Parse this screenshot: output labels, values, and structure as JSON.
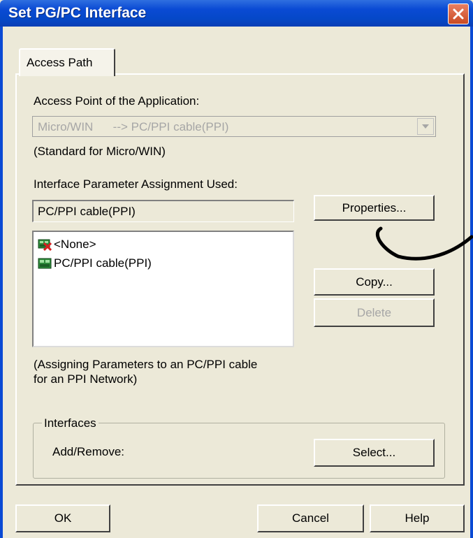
{
  "window": {
    "title": "Set PG/PC Interface"
  },
  "tabs": [
    {
      "label": "Access Path"
    }
  ],
  "access_point": {
    "label": "Access Point of the Application:",
    "value": "Micro/WIN      --> PC/PPI cable(PPI)",
    "note": "(Standard for Micro/WIN)"
  },
  "interface_param": {
    "label": "Interface Parameter Assignment Used:",
    "value": "PC/PPI cable(PPI)",
    "list": [
      {
        "label": "<None>",
        "icon": "none-interface-icon"
      },
      {
        "label": "PC/PPI cable(PPI)",
        "icon": "pc-ppi-cable-icon"
      }
    ],
    "description_line1": "(Assigning Parameters to an PC/PPI cable",
    "description_line2": "for an PPI Network)"
  },
  "buttons": {
    "properties": "Properties...",
    "copy": "Copy...",
    "delete": "Delete",
    "select": "Select...",
    "ok": "OK",
    "cancel": "Cancel",
    "help": "Help"
  },
  "interfaces_group": {
    "legend": "Interfaces",
    "add_remove_label": "Add/Remove:"
  },
  "colors": {
    "title_bar": "#0a4ad4",
    "dialog_bg": "#ece9d8",
    "close_button": "#c94a22",
    "disabled_text": "#a6a6a6",
    "annotation_ink": "#000000"
  }
}
